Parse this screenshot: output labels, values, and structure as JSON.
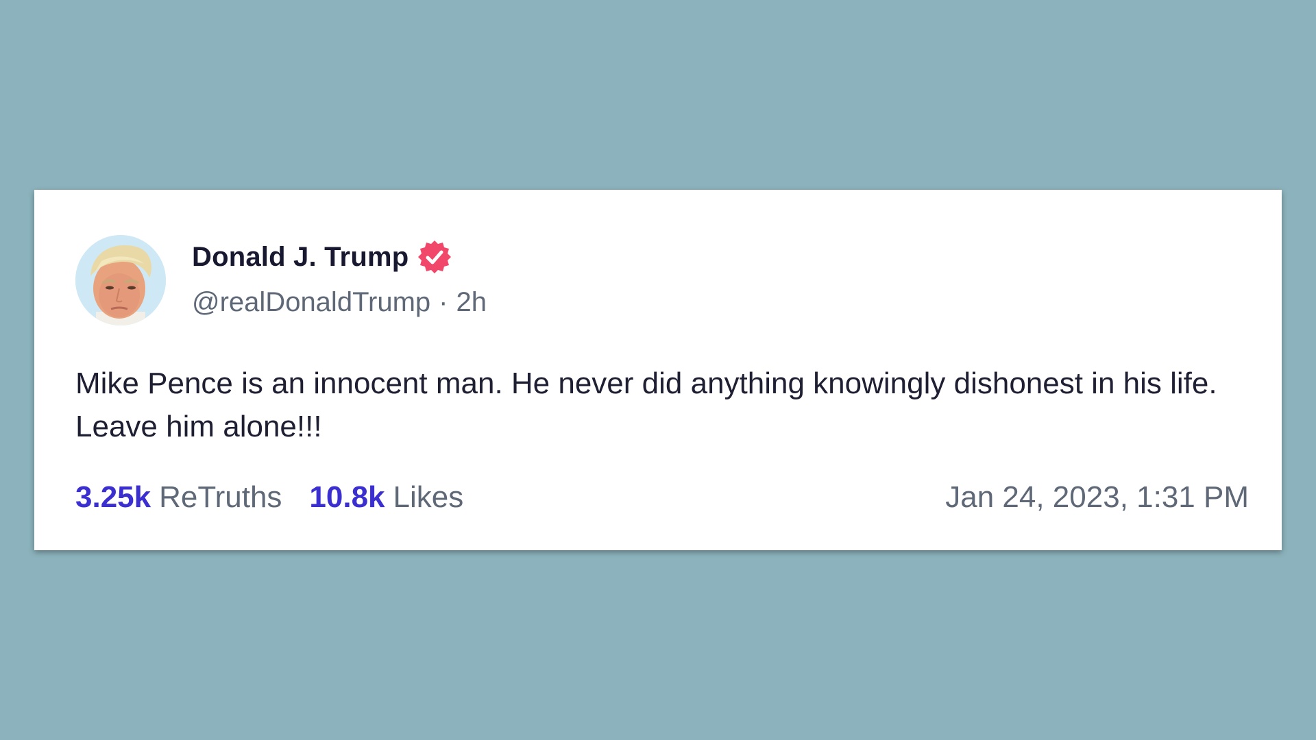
{
  "post": {
    "author": {
      "display_name": "Donald J. Trump",
      "handle": "@realDonaldTrump",
      "verified": true,
      "avatar_icon": "avatar-portrait"
    },
    "separator": "·",
    "relative_time": "2h",
    "text": "Mike Pence is an innocent man. He never did anything knowingly dishonest in his life. Leave him alone!!!",
    "stats": {
      "retruths": {
        "count": "3.25k",
        "label": "ReTruths"
      },
      "likes": {
        "count": "10.8k",
        "label": "Likes"
      }
    },
    "timestamp": "Jan 24, 2023, 1:31 PM"
  },
  "colors": {
    "background": "#8cb3bd",
    "card": "#ffffff",
    "name": "#181830",
    "muted": "#5f6877",
    "stat_count": "#3b2fd0",
    "verified_badge": "#f0476a"
  },
  "icons": {
    "verified": "verified-badge-icon"
  }
}
